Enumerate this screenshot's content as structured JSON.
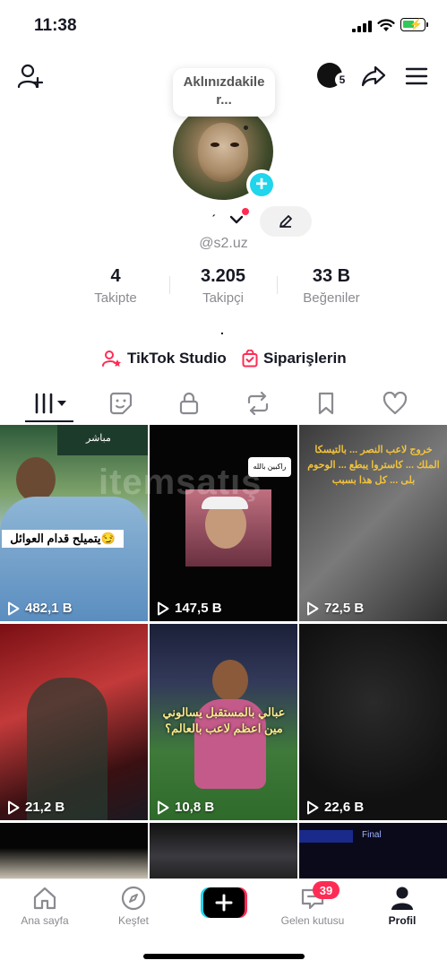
{
  "status_bar": {
    "time": "11:38"
  },
  "header": {
    "bubble_text_line1": "Aklınızdakile",
    "bubble_text_line2": "r...",
    "notification_count": "5"
  },
  "profile": {
    "display_name_glyph": "ˏ",
    "handle": "@s2.uz",
    "stats": [
      {
        "value": "4",
        "label": "Takipte"
      },
      {
        "value": "3.205",
        "label": "Takipçi"
      },
      {
        "value": "33 B",
        "label": "Beğeniler"
      }
    ],
    "bio_dot": ".",
    "links": [
      {
        "label": "TikTok Studio",
        "icon": "person-star-icon"
      },
      {
        "label": "Siparişlerin",
        "icon": "shopping-bag-icon"
      }
    ]
  },
  "tabs": [
    {
      "icon": "videos-grid-icon"
    },
    {
      "icon": "sticker-icon"
    },
    {
      "icon": "lock-icon"
    },
    {
      "icon": "repost-icon"
    },
    {
      "icon": "bookmark-icon"
    },
    {
      "icon": "heart-icon"
    }
  ],
  "videos": [
    {
      "views": "482,1 B",
      "caption": "يتميلح قدام العوائل😏",
      "overlay": "مباشر"
    },
    {
      "views": "147,5 B",
      "caption": "راكبين بالله",
      "overlay": ""
    },
    {
      "views": "72,5 B",
      "caption": "خروج لاعب النصر ... بالتيسكا الملك ... كاستروا يبطع ... الوحوم بلى ... كل هذا بسبب",
      "overlay": ""
    },
    {
      "views": "21,2 B",
      "caption": "",
      "overlay": ""
    },
    {
      "views": "10,8 B",
      "caption_line1": "عبالي بالمستقبل يسالوني",
      "caption_line2": "مين اعظم لاعب بالعالم؟",
      "overlay": ""
    },
    {
      "views": "22,6 B",
      "caption": "",
      "overlay": ""
    },
    {
      "views": "",
      "caption": "",
      "overlay": ""
    },
    {
      "views": "",
      "caption": "",
      "overlay": ""
    },
    {
      "views": "",
      "caption": "",
      "overlay": "Final"
    }
  ],
  "watermark": "itemsatış",
  "bottom_nav": {
    "items": [
      {
        "label": "Ana sayfa",
        "icon": "home-icon"
      },
      {
        "label": "Keşfet",
        "icon": "compass-icon"
      },
      {
        "label": "",
        "icon": "create-plus-icon"
      },
      {
        "label": "Gelen kutusu",
        "icon": "inbox-icon"
      },
      {
        "label": "Profil",
        "icon": "profile-icon"
      }
    ],
    "inbox_badge": "39"
  },
  "colors": {
    "accent_red": "#fe2c55",
    "accent_cyan": "#20d5ec",
    "text_primary": "#161823",
    "text_secondary": "#8a8b91",
    "battery_green": "#34c759"
  }
}
